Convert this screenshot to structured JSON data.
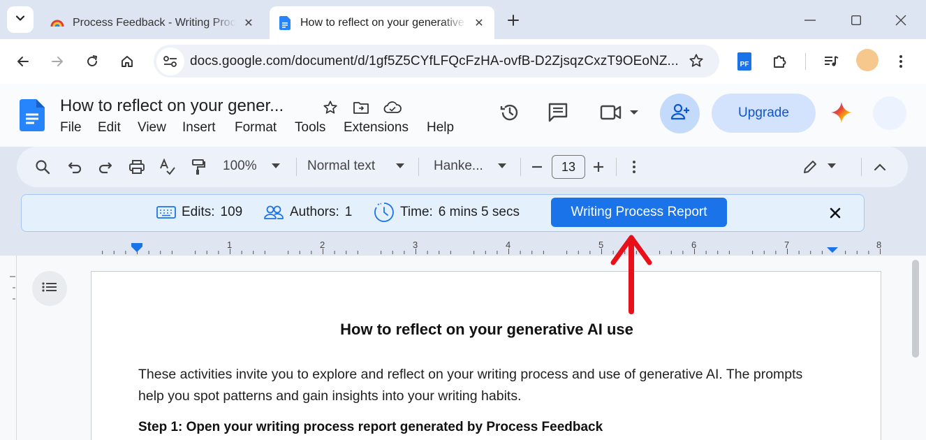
{
  "browser": {
    "tabs": [
      {
        "title": "Process Feedback - Writing Process",
        "active": false
      },
      {
        "title": "How to reflect on your generative AI use",
        "active": true
      }
    ],
    "url": "docs.google.com/document/d/1gf5Z5CYfLFQcFzHA-ovfB-D2ZjsqzCxzT9OEoNZ...",
    "extension_label": "PF"
  },
  "docs": {
    "title": "How to reflect on your gener...",
    "menu": [
      "File",
      "Edit",
      "View",
      "Insert",
      "Format",
      "Tools",
      "Extensions",
      "Help"
    ],
    "upgrade_label": "Upgrade",
    "toolbar": {
      "zoom": "100%",
      "style": "Normal text",
      "font": "Hanke...",
      "font_size": "13"
    }
  },
  "process_feedback": {
    "edits_label": "Edits:",
    "edits_value": "109",
    "authors_label": "Authors:",
    "authors_value": "1",
    "time_label": "Time:",
    "time_value": "6 mins 5 secs",
    "report_button": "Writing Process Report",
    "accent_color": "#1a73e8"
  },
  "ruler": {
    "numbers": [
      "1",
      "2",
      "3",
      "4",
      "5",
      "6",
      "7",
      "8"
    ]
  },
  "document": {
    "heading": "How to reflect on your generative AI use",
    "paragraph": "These activities invite you to explore and reflect on your writing process and use of generative AI. The prompts help you spot patterns and gain insights into your writing habits.",
    "step1": "Step 1: Open your writing process report generated by Process Feedback"
  },
  "annotation": {
    "color": "#e8101a",
    "icon": "red-arrow-up"
  }
}
